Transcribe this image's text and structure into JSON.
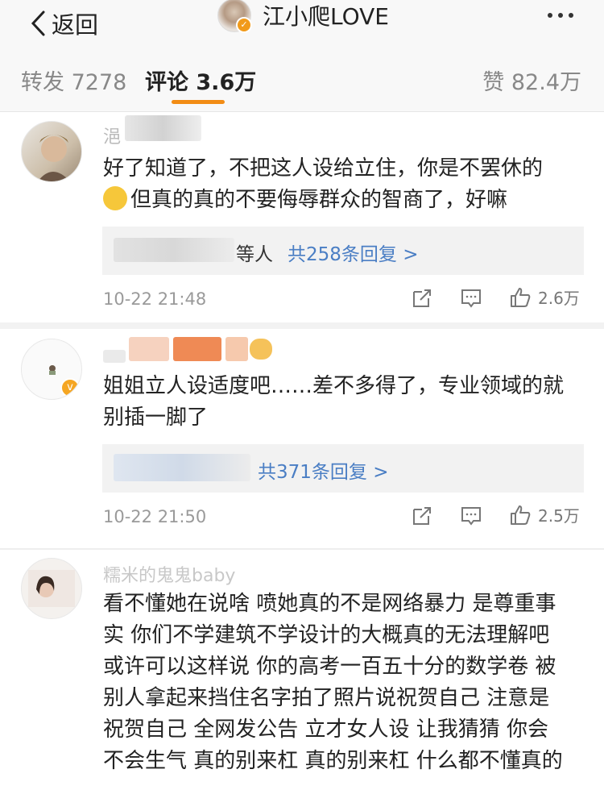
{
  "navbar": {
    "back_label": "返回",
    "title": "江小爬LOVE"
  },
  "tabs": {
    "repost": "转发 7278",
    "comments": "评论 3.6万",
    "likes": "赞 82.4万"
  },
  "comments": [
    {
      "username_partial": "浥",
      "text_line1": "好了知道了，不把这人设给立住，你是不罢休的",
      "text_line2": "但真的真的不要侮辱群众的智商了，好嘛",
      "reply_prefix": "等人",
      "reply_count": "共258条回复 >",
      "time": "10-22 21:48",
      "likes": "2.6万"
    },
    {
      "text_line1": "姐姐立人设适度吧……差不多得了，专业领域的就",
      "text_line2": "别插一脚了",
      "reply_count": "共371条回复 >",
      "time": "10-22 21:50",
      "likes": "2.5万"
    },
    {
      "username_partial": "糯米的鬼鬼baby",
      "lines": [
        "看不懂她在说啥 喷她真的不是网络暴力 是尊重事",
        "实 你们不学建筑不学设计的大概真的无法理解吧",
        "或许可以这样说 你的高考一百五十分的数学卷 被",
        "别人拿起来挡住名字拍了照片说祝贺自己 注意是",
        "祝贺自己 全网发公告 立才女人设 让我猜猜 你会",
        "不会生气 真的别来杠 真的别来杠 什么都不懂真的"
      ]
    }
  ],
  "icons": {
    "back": "chevron-left-icon",
    "more": "more-dots-icon",
    "repost": "share-icon",
    "comment": "comment-icon",
    "like": "thumbs-up-icon"
  },
  "colors": {
    "accent": "#f28c15",
    "link": "#4a7ec4",
    "verified": "#f5a623"
  }
}
